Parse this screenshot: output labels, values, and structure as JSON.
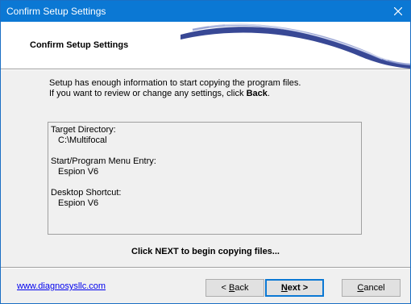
{
  "window": {
    "title": "Confirm Setup Settings",
    "close_icon": "close-icon"
  },
  "header": {
    "title": "Confirm Setup Settings"
  },
  "intro": {
    "line1": "Setup has enough information to start copying the program files.",
    "line2_prefix": "If you want to review or change any settings, click ",
    "line2_bold": "Back",
    "line2_suffix": "."
  },
  "settings": {
    "target_directory_label": "Target Directory:",
    "target_directory_value": "C:\\Multifocal",
    "start_menu_label": "Start/Program Menu Entry:",
    "start_menu_value": "Espion V6",
    "desktop_shortcut_label": "Desktop Shortcut:",
    "desktop_shortcut_value": "Espion V6"
  },
  "next_message": "Click NEXT to begin copying files...",
  "footer": {
    "link_text": "www.diagnosysllc.com",
    "back_prefix": "< ",
    "back_mnemonic": "B",
    "back_rest": "ack",
    "next_mnemonic": "N",
    "next_rest": "ext >",
    "cancel_mnemonic": "C",
    "cancel_rest": "ancel"
  },
  "colors": {
    "titlebar": "#0b78d4",
    "swoosh": "#2d3e8f",
    "link": "#0000ee"
  }
}
